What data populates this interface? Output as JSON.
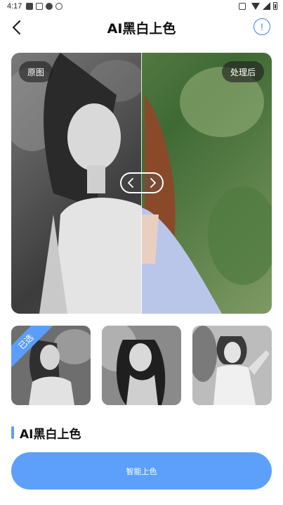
{
  "status_bar": {
    "time": "4:17",
    "left_icons": [
      "app-icon",
      "photo-icon",
      "chat-icon",
      "notification-icon"
    ],
    "right_icons": [
      "vibrate-icon",
      "wifi-icon",
      "signal-icon",
      "battery-icon"
    ]
  },
  "header": {
    "title": "AI黑白上色",
    "back_icon": "chevron-left-icon",
    "info_icon": "info-icon",
    "info_glyph": "!"
  },
  "compare": {
    "left_tag": "原图",
    "right_tag": "处理后",
    "slider_position": 0.5
  },
  "thumbnails": {
    "selected_label": "已选",
    "selected_index": 0,
    "count": 3
  },
  "section": {
    "title": "AI黑白上色"
  },
  "action": {
    "label": "智能上色"
  },
  "colors": {
    "accent": "#5ca0fb",
    "info": "#3e7df5"
  }
}
